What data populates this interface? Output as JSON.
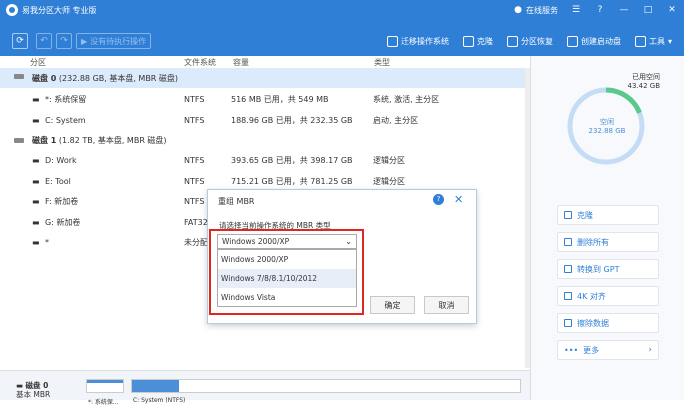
{
  "titlebar": {
    "title": "易我分区大师 专业版",
    "service": "在线服务"
  },
  "toolbar": {
    "pending_label": "没有待执行操作",
    "tools": [
      {
        "name": "migrate-os-tool",
        "icon": "migrate-icon",
        "label": "迁移操作系统"
      },
      {
        "name": "clone-tool",
        "icon": "clone-icon",
        "label": "克隆"
      },
      {
        "name": "partition-recovery-tool",
        "icon": "partition-recovery-icon",
        "label": "分区恢复"
      },
      {
        "name": "create-boot-disk-tool",
        "icon": "boot-disk-icon",
        "label": "创建启动盘"
      },
      {
        "name": "tools-menu",
        "icon": "wrench-icon",
        "label": "工具"
      }
    ]
  },
  "table": {
    "headers": {
      "partition": "分区",
      "filesystem": "文件系统",
      "capacity": "容量",
      "type": "类型"
    },
    "disk0": {
      "name": "磁盘 0",
      "info": "(232.88 GB, 基本盘, MBR 磁盘)"
    },
    "disk1": {
      "name": "磁盘 1",
      "info": "(1.82 TB, 基本盘, MBR 磁盘)"
    },
    "rows": [
      {
        "name": "*: 系统保留",
        "fs": "NTFS",
        "cap": "516 MB 已用，共 549 MB",
        "type": "系统, 激活, 主分区"
      },
      {
        "name": "C: System",
        "fs": "NTFS",
        "cap": "188.96 GB 已用，共 232.35 GB",
        "type": "启动, 主分区"
      },
      {
        "name": "D: Work",
        "fs": "NTFS",
        "cap": "393.65 GB 已用，共 398.17 GB",
        "type": "逻辑分区"
      },
      {
        "name": "E: Tool",
        "fs": "NTFS",
        "cap": "715.21 GB 已用，共 781.25 GB",
        "type": "逻辑分区"
      },
      {
        "name": "F: 新加卷",
        "fs": "NTFS",
        "cap": "",
        "type": ""
      },
      {
        "name": "G: 新加卷",
        "fs": "FAT32",
        "cap": "",
        "type": ""
      },
      {
        "name": "*",
        "fs": "未分配",
        "cap": "",
        "type": ""
      }
    ]
  },
  "usage": {
    "used_label": "已用空间",
    "used_value": "43.42 GB",
    "free_label": "空闲",
    "free_value": "232.88 GB",
    "used_fraction": 0.19,
    "used_color": "#5cc98b",
    "free_color": "#c5dcf5"
  },
  "actions": [
    {
      "label": "克隆",
      "icon": "clone-icon"
    },
    {
      "label": "删除所有",
      "icon": "trash-icon"
    },
    {
      "label": "转换到 GPT",
      "icon": "convert-icon"
    },
    {
      "label": "4K 对齐",
      "icon": "align-icon"
    },
    {
      "label": "擦除数据",
      "icon": "eraser-icon"
    },
    {
      "label": "更多",
      "icon": "more-icon"
    }
  ],
  "bottom": {
    "disk_name": "磁盘 0",
    "disk_type": "基本 MBR",
    "part1": "*: 系统保...",
    "part2": "C: System (NTFS)"
  },
  "dialog": {
    "title": "重组 MBR",
    "prompt": "请选择当前操作系统的 MBR 类型",
    "selected": "Windows 2000/XP",
    "options": [
      "Windows 2000/XP",
      "Windows 7/8/8.1/10/2012",
      "Windows Vista"
    ],
    "ok_label": "确定",
    "cancel_label": "取消"
  },
  "colors": {
    "accent": "#2f7fd6",
    "highlight_border": "#e0271f"
  }
}
